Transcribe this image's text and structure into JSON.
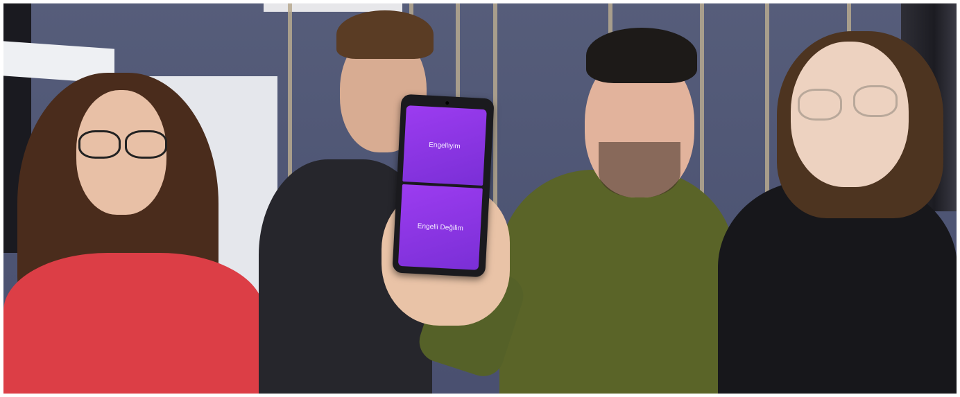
{
  "photo": {
    "phone_screen": {
      "top_button_label": "Engelliyim",
      "bottom_button_label": "Engelli Değilim"
    }
  },
  "colors": {
    "wall": "#515875",
    "screen_purple": "#8a35e4",
    "red_sweater": "#e0404a",
    "olive_shirt": "#5b6528",
    "black_hoodie": "#17171b"
  }
}
